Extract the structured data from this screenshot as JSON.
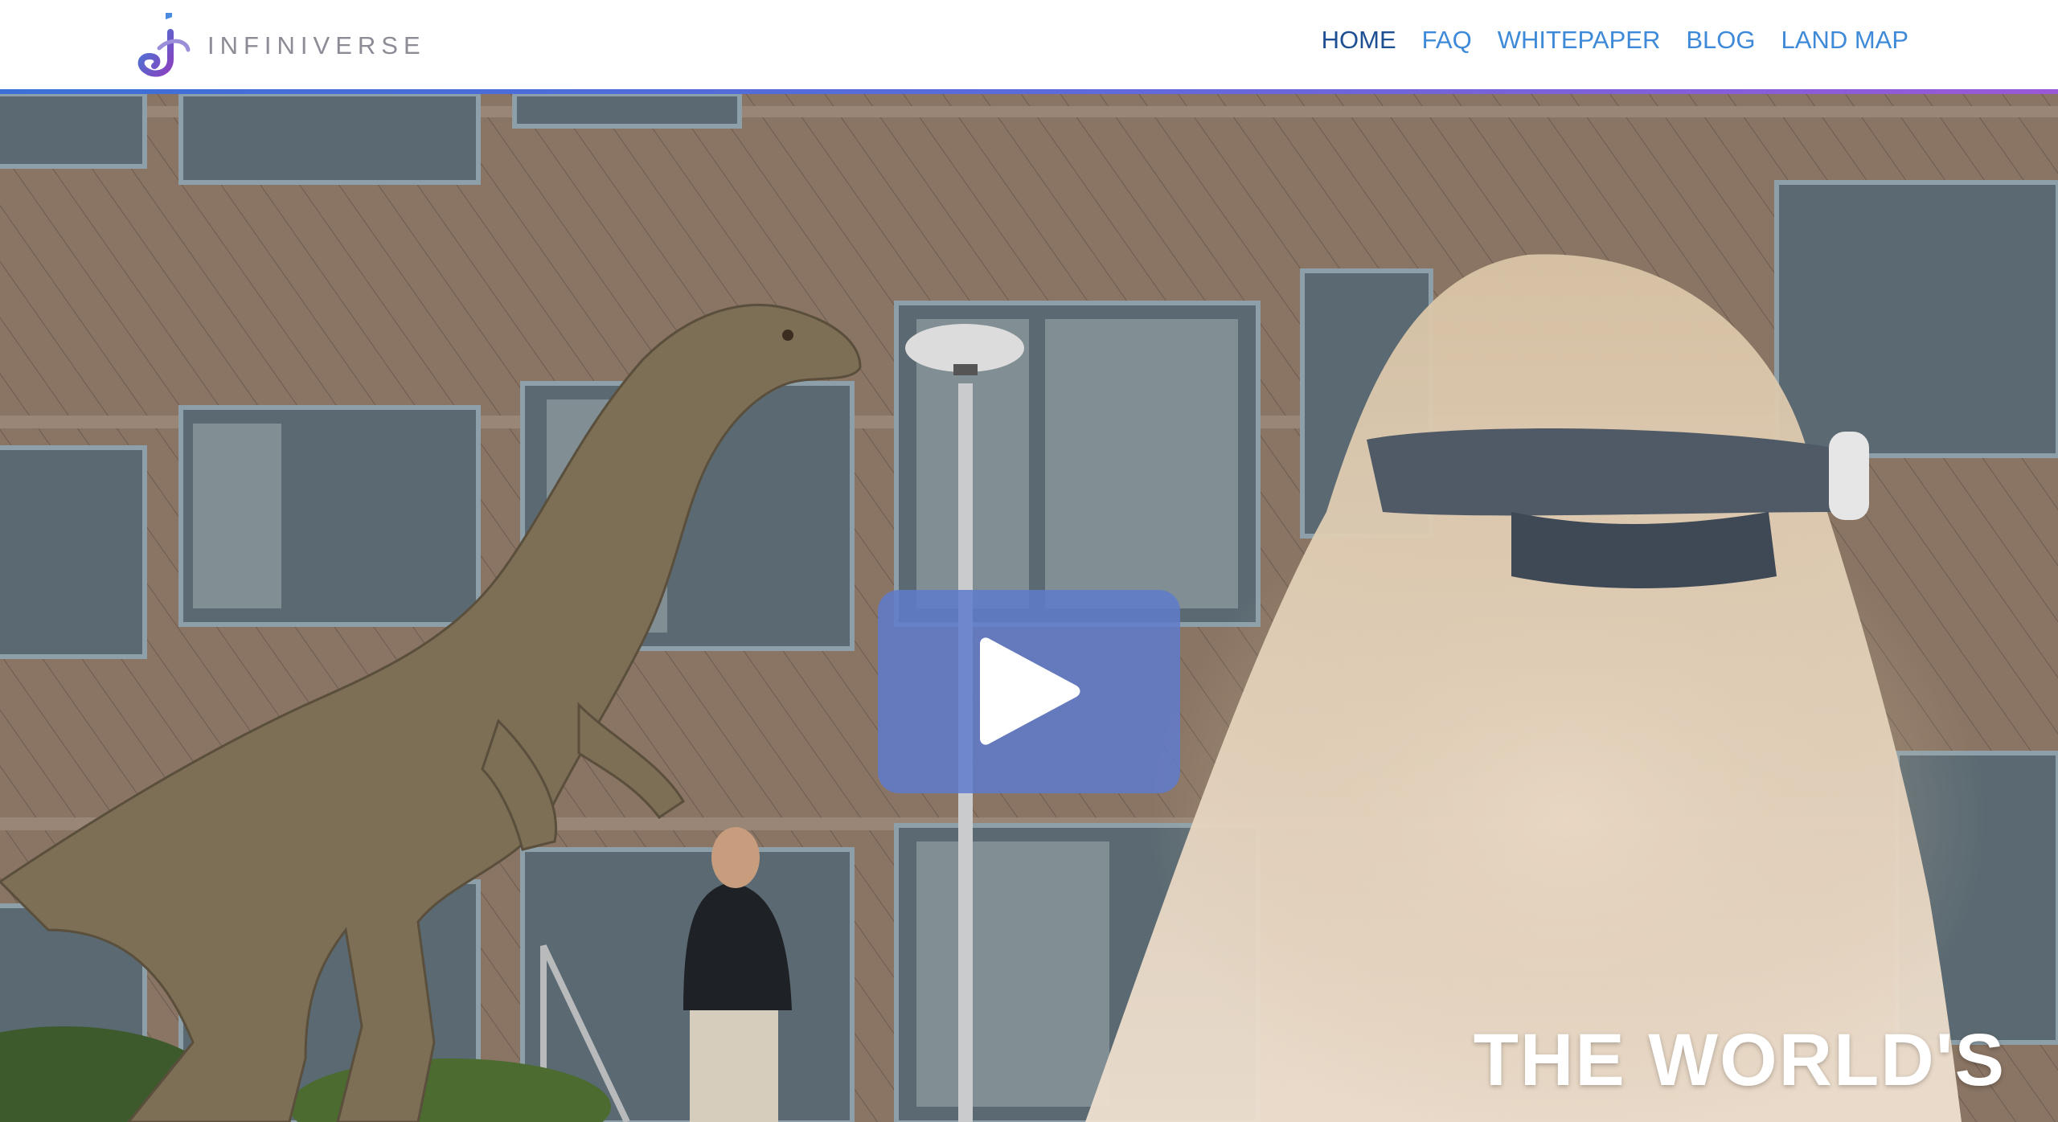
{
  "brand": {
    "name": "INFINIVERSE",
    "logo_icon": "infiniverse-logo-icon"
  },
  "nav": {
    "items": [
      {
        "label": "HOME",
        "active": true
      },
      {
        "label": "FAQ",
        "active": false
      },
      {
        "label": "WHITEPAPER",
        "active": false
      },
      {
        "label": "BLOG",
        "active": false
      },
      {
        "label": "LAND MAP",
        "active": false
      }
    ]
  },
  "hero": {
    "headline": "THE WORLD'S",
    "play_icon": "play-icon"
  },
  "colors": {
    "nav_link": "#3e8ad8",
    "nav_active": "#1f4f93",
    "accent_start": "#3c6fd6",
    "accent_end": "#9b58d8",
    "play_button": "#607ccc"
  }
}
